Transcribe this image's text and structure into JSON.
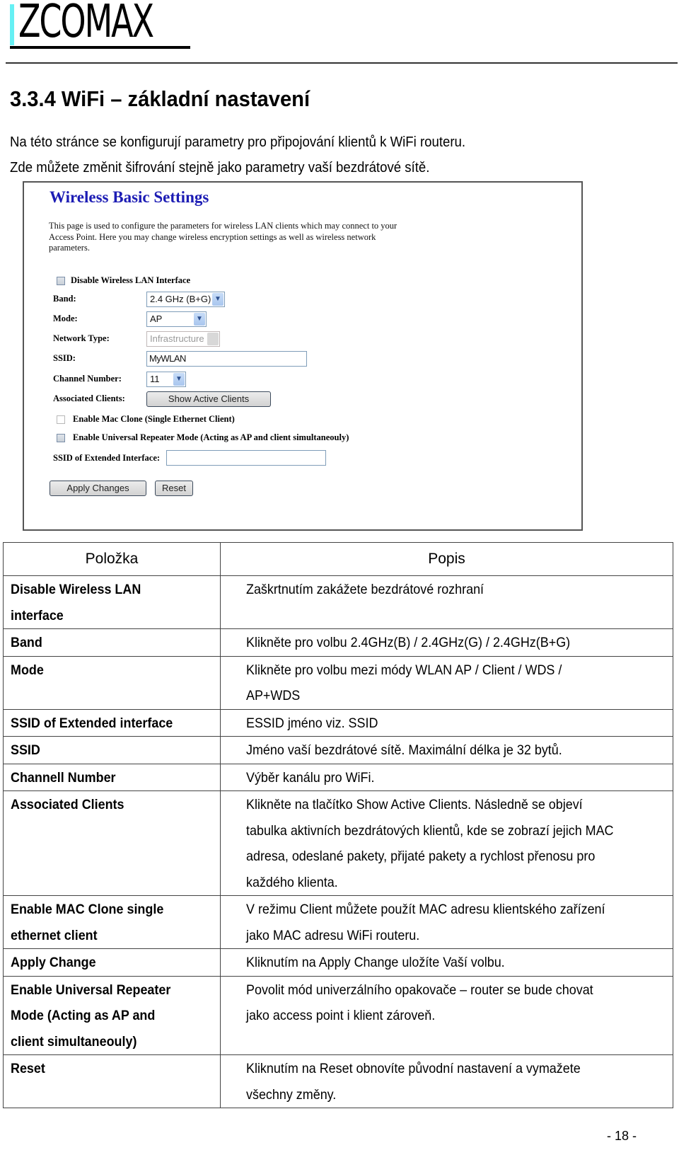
{
  "header": {
    "logo_text": "ZCOMAX",
    "brand_accent": "#66f0f4"
  },
  "section": {
    "title": "3.3.4  WiFi – základní nastavení",
    "intro": [
      "Na této stránce se konfigurují parametry pro připojování klientů k WiFi routeru.",
      "Zde můžete změnit šifrování stejně jako parametry vaší bezdrátové sítě."
    ]
  },
  "screenshot": {
    "title": "Wireless Basic Settings",
    "title_color": "#1c1cb4",
    "description": "This page is used to configure the parameters for wireless LAN clients which may connect to your Access Point. Here you may change wireless encryption settings as well as wireless network parameters.",
    "disable_wlan_label": "Disable Wireless LAN Interface",
    "disable_wlan_checked": false,
    "band_label": "Band:",
    "band_value": "2.4 GHz (B+G)",
    "mode_label": "Mode:",
    "mode_value": "AP",
    "network_type_label": "Network Type:",
    "network_type_value": "Infrastructure",
    "ssid_label": "SSID:",
    "ssid_value": "MyWLAN",
    "channel_label": "Channel Number:",
    "channel_value": "11",
    "assoc_label": "Associated Clients:",
    "show_clients_button": "Show Active Clients",
    "mac_clone_label": "Enable Mac Clone (Single Ethernet Client)",
    "mac_clone_checked": false,
    "repeater_label": "Enable Universal Repeater Mode (Acting as AP and client simultaneouly)",
    "repeater_checked": false,
    "ext_ssid_label": "SSID of Extended Interface:",
    "ext_ssid_value": "",
    "apply_button": "Apply Changes",
    "reset_button": "Reset"
  },
  "table": {
    "headers": [
      "Položka",
      "Popis"
    ],
    "rows": [
      {
        "item": [
          "Disable Wireless LAN",
          "interface"
        ],
        "desc": [
          "Zaškrtnutím zakážete bezdrátové rozhraní"
        ]
      },
      {
        "item": [
          "Band"
        ],
        "desc": [
          "Klikněte pro volbu 2.4GHz(B) / 2.4GHz(G) / 2.4GHz(B+G)"
        ]
      },
      {
        "item": [
          "Mode"
        ],
        "desc": [
          "Klikněte pro volbu mezi módy WLAN AP / Client / WDS /",
          "AP+WDS"
        ]
      },
      {
        "item": [
          "SSID of Extended interface"
        ],
        "desc": [
          "ESSID jméno viz. SSID"
        ]
      },
      {
        "item": [
          "SSID"
        ],
        "desc": [
          "Jméno vaší bezdrátové sítě. Maximální délka je 32 bytů."
        ]
      },
      {
        "item": [
          "Channell Number"
        ],
        "desc": [
          "Výběr kanálu pro WiFi."
        ]
      },
      {
        "item": [
          "Associated Clients"
        ],
        "desc": [
          "Klikněte na tlačítko Show Active Clients. Následně se objeví",
          "tabulka aktivních bezdrátových klientů, kde se zobrazí jejich MAC",
          "adresa, odeslané pakety, přijaté pakety a rychlost přenosu pro",
          "každého klienta."
        ]
      },
      {
        "item": [
          "Enable MAC Clone single",
          "ethernet client"
        ],
        "desc": [
          "V režimu Client můžete použít MAC adresu klientského zařízení",
          "jako MAC adresu WiFi routeru."
        ]
      },
      {
        "item": [
          "Apply Change"
        ],
        "desc": [
          "Kliknutím na Apply Change uložíte Vaší volbu."
        ]
      },
      {
        "item": [
          "Enable Universal Repeater",
          "Mode (Acting as AP and",
          "client simultaneouly)"
        ],
        "desc": [
          "Povolit mód univerzálního opakovače – router se bude chovat",
          "jako access point i klient zároveň."
        ]
      },
      {
        "item": [
          "Reset"
        ],
        "desc": [
          "Kliknutím na Reset obnovíte původní nastavení a vymažete",
          "všechny změny."
        ]
      }
    ]
  },
  "footer": {
    "page_number": "- 18 -"
  }
}
